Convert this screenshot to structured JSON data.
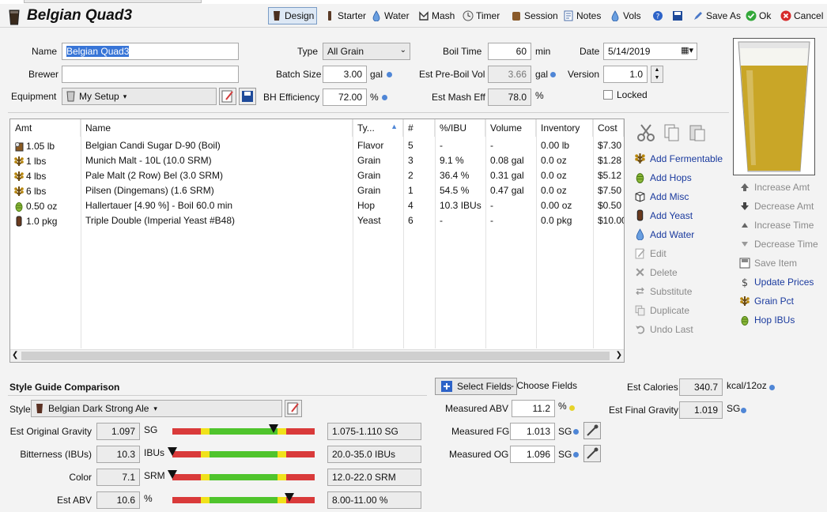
{
  "header": {
    "title": "Belgian Quad3",
    "toolbar": [
      {
        "label": "Design",
        "icon": "glass-icon",
        "active": true
      },
      {
        "label": "Starter",
        "icon": "flask-icon"
      },
      {
        "label": "Water",
        "icon": "water-drop-icon"
      },
      {
        "label": "Mash",
        "icon": "mash-icon"
      },
      {
        "label": "Timer",
        "icon": "clock-icon"
      },
      {
        "label": "Session",
        "icon": "keg-icon"
      },
      {
        "label": "Notes",
        "icon": "notes-icon"
      },
      {
        "label": "Vols",
        "icon": "water-drop-icon"
      }
    ],
    "save_as": "Save As",
    "ok": "Ok",
    "cancel": "Cancel"
  },
  "form": {
    "name_label": "Name",
    "name_value": "Belgian Quad3",
    "brewer_label": "Brewer",
    "brewer_value": "",
    "equipment_label": "Equipment",
    "equipment_value": "My Setup",
    "type_label": "Type",
    "type_value": "All Grain",
    "batch_size_label": "Batch Size",
    "batch_size_value": "3.00",
    "batch_size_unit": "gal",
    "bh_eff_label": "BH Efficiency",
    "bh_eff_value": "72.00",
    "bh_eff_unit": "%",
    "boil_time_label": "Boil Time",
    "boil_time_value": "60",
    "boil_time_unit": "min",
    "pre_boil_label": "Est Pre-Boil Vol",
    "pre_boil_value": "3.66",
    "pre_boil_unit": "gal",
    "mash_eff_label": "Est Mash Eff",
    "mash_eff_value": "78.0",
    "mash_eff_unit": "%",
    "date_label": "Date",
    "date_value": "5/14/2019",
    "version_label": "Version",
    "version_value": "1.0",
    "locked_label": "Locked"
  },
  "grid": {
    "columns": [
      "Amt",
      "Name",
      "Ty...",
      "#",
      "%/IBU",
      "Volume",
      "Inventory",
      "Cost"
    ],
    "rows": [
      {
        "icon": "sugar-icon",
        "amt": "1.05 lb",
        "name": "Belgian Candi Sugar D-90 (Boil)",
        "type": "Flavor",
        "num": "5",
        "pct": "-",
        "vol": "-",
        "inv": "0.00 lb",
        "cost": "$7.30"
      },
      {
        "icon": "grain-icon",
        "amt": "1 lbs",
        "name": "Munich Malt - 10L (10.0 SRM)",
        "type": "Grain",
        "num": "3",
        "pct": "9.1 %",
        "vol": "0.08 gal",
        "inv": "0.0 oz",
        "cost": "$1.28"
      },
      {
        "icon": "grain-icon",
        "amt": "4 lbs",
        "name": "Pale Malt (2 Row) Bel (3.0 SRM)",
        "type": "Grain",
        "num": "2",
        "pct": "36.4 %",
        "vol": "0.31 gal",
        "inv": "0.0 oz",
        "cost": "$5.12"
      },
      {
        "icon": "grain-icon",
        "amt": "6 lbs",
        "name": "Pilsen (Dingemans) (1.6 SRM)",
        "type": "Grain",
        "num": "1",
        "pct": "54.5 %",
        "vol": "0.47 gal",
        "inv": "0.0 oz",
        "cost": "$7.50"
      },
      {
        "icon": "hop-icon",
        "amt": "0.50 oz",
        "name": "Hallertauer [4.90 %] - Boil 60.0 min",
        "type": "Hop",
        "num": "4",
        "pct": "10.3 IBUs",
        "vol": "-",
        "inv": "0.00 oz",
        "cost": "$0.50"
      },
      {
        "icon": "yeast-icon",
        "amt": "1.0 pkg",
        "name": "Triple Double (Imperial Yeast #B48)",
        "type": "Yeast",
        "num": "6",
        "pct": "-",
        "vol": "-",
        "inv": "0.0 pkg",
        "cost": "$10.00"
      }
    ]
  },
  "actions": [
    {
      "label": "Add Fermentable",
      "icon": "grain-icon",
      "enabled": true
    },
    {
      "label": "Add Hops",
      "icon": "hop-icon",
      "enabled": true
    },
    {
      "label": "Add Misc",
      "icon": "misc-icon",
      "enabled": true
    },
    {
      "label": "Add Yeast",
      "icon": "yeast-icon",
      "enabled": true
    },
    {
      "label": "Add Water",
      "icon": "water-drop-icon",
      "enabled": true
    },
    {
      "label": "Edit",
      "icon": "edit-icon",
      "enabled": false
    },
    {
      "label": "Delete",
      "icon": "delete-icon",
      "enabled": false
    },
    {
      "label": "Substitute",
      "icon": "substitute-icon",
      "enabled": false
    },
    {
      "label": "Duplicate",
      "icon": "duplicate-icon",
      "enabled": false
    },
    {
      "label": "Undo Last",
      "icon": "undo-icon",
      "enabled": false
    }
  ],
  "side_actions": [
    {
      "label": "Increase Amt",
      "icon": "arrow-up-icon",
      "enabled": false
    },
    {
      "label": "Decrease Amt",
      "icon": "arrow-down-icon",
      "enabled": false
    },
    {
      "label": "Increase Time",
      "icon": "triangle-up-icon",
      "enabled": false
    },
    {
      "label": "Decrease Time",
      "icon": "triangle-down-icon",
      "enabled": false
    },
    {
      "label": "Save Item",
      "icon": "save-icon",
      "enabled": false
    },
    {
      "label": "Update Prices",
      "icon": "dollar-icon",
      "enabled": true
    },
    {
      "label": "Grain Pct",
      "icon": "grain-icon",
      "enabled": true
    },
    {
      "label": "Hop IBUs",
      "icon": "hop-icon",
      "enabled": true
    }
  ],
  "style_guide": {
    "title": "Style Guide Comparison",
    "style_label": "Style",
    "style_value": "Belgian Dark Strong Ale",
    "rows": [
      {
        "label": "Est Original Gravity",
        "value": "1.097",
        "unit": "SG",
        "range": "1.075-1.110 SG",
        "marker": 0.71
      },
      {
        "label": "Bitterness (IBUs)",
        "value": "10.3",
        "unit": "IBUs",
        "range": "20.0-35.0 IBUs",
        "marker": 0.0
      },
      {
        "label": "Color",
        "value": "7.1",
        "unit": "SRM",
        "range": "12.0-22.0 SRM",
        "marker": 0.0
      },
      {
        "label": "Est ABV",
        "value": "10.6",
        "unit": "%",
        "range": "8.00-11.00 %",
        "marker": 0.82
      }
    ]
  },
  "measured": {
    "select_fields": "Select Fields",
    "choose_fields": "- Choose Fields",
    "abv_label": "Measured ABV",
    "abv_value": "11.2",
    "abv_unit": "%",
    "fg_label": "Measured FG",
    "fg_value": "1.013",
    "fg_unit": "SG",
    "og_label": "Measured OG",
    "og_value": "1.096",
    "og_unit": "SG",
    "calories_label": "Est Calories",
    "calories_value": "340.7",
    "calories_unit": "kcal/12oz",
    "final_gravity_label": "Est Final Gravity",
    "final_gravity_value": "1.019",
    "final_gravity_unit": "SG"
  },
  "colors": {
    "beer": "#c9a627",
    "accent": "#4f86d6",
    "bar_red": "#d93a3a",
    "bar_yellow": "#f0e21b",
    "bar_green": "#4fc42c"
  }
}
